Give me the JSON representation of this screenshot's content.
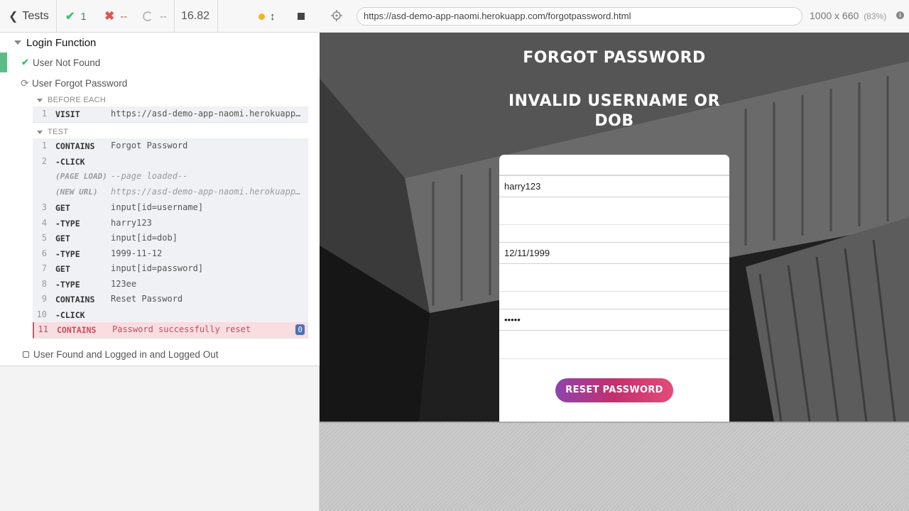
{
  "reporter": {
    "tests_label": "Tests",
    "passed": "1",
    "failed": "--",
    "pending": "--",
    "duration": "16.82"
  },
  "suite": {
    "title": "Login Function",
    "tests": [
      {
        "label": "User Not Found",
        "state": "passed"
      },
      {
        "label": "User Forgot Password",
        "state": "running"
      },
      {
        "label": "User Found and Logged in and Logged Out",
        "state": "pending"
      }
    ],
    "before_each_label": "BEFORE EACH",
    "test_label": "TEST",
    "before_each_cmds": [
      {
        "num": "1",
        "name": "VISIT",
        "msg": "https://asd-demo-app-naomi.herokuapp.com/forgotpassword.html"
      }
    ],
    "test_cmds": [
      {
        "num": "1",
        "name": "CONTAINS",
        "msg": "Forgot Password"
      },
      {
        "num": "2",
        "name": "-CLICK",
        "msg": ""
      },
      {
        "num": "",
        "name": "(PAGE LOAD)",
        "msg": "--page loaded--"
      },
      {
        "num": "",
        "name": "(NEW URL)",
        "msg": "https://asd-demo-app-naomi.herokuapp.com/forgotpassword.html"
      },
      {
        "num": "3",
        "name": "GET",
        "msg": "input[id=username]"
      },
      {
        "num": "4",
        "name": "-TYPE",
        "msg": "harry123"
      },
      {
        "num": "5",
        "name": "GET",
        "msg": "input[id=dob]"
      },
      {
        "num": "6",
        "name": "-TYPE",
        "msg": "1999-11-12"
      },
      {
        "num": "7",
        "name": "GET",
        "msg": "input[id=password]"
      },
      {
        "num": "8",
        "name": "-TYPE",
        "msg": "123ee"
      },
      {
        "num": "9",
        "name": "CONTAINS",
        "msg": "Reset Password"
      },
      {
        "num": "10",
        "name": "-CLICK",
        "msg": ""
      },
      {
        "num": "11",
        "name": "CONTAINS",
        "msg": "Password successfully reset",
        "badge": "0"
      }
    ]
  },
  "app_bar": {
    "url": "https://asd-demo-app-naomi.herokuapp.com/forgotpassword.html",
    "viewport": "1000 x 660",
    "scale": "(83%)"
  },
  "app": {
    "heading": "FORGOT PASSWORD",
    "error_line1": "INVALID USERNAME OR",
    "error_line2": "DOB",
    "username_value": "harry123",
    "dob_value": "12/11/1999",
    "password_value": "•••••",
    "reset_button": "RESET PASSWORD"
  },
  "colors": {
    "pass": "#3ec26e",
    "fail": "#e05252",
    "pending_dot": "#f0b429",
    "button_gradient_start": "#8e44ad",
    "button_gradient_end": "#e24c78"
  }
}
